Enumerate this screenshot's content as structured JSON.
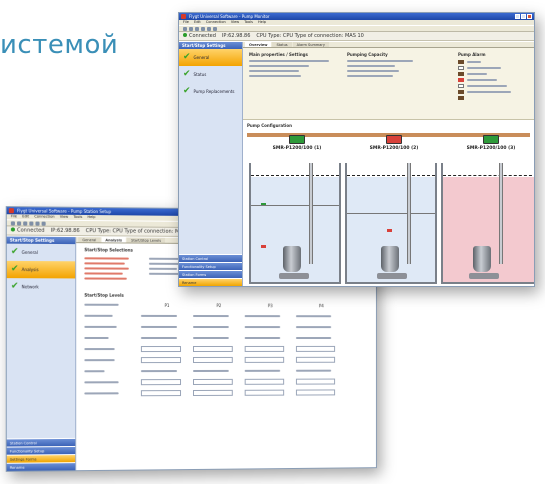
{
  "promo": {
    "text": "истемой"
  },
  "back_window": {
    "title": "Flygt Universal Software - Pump Station Setup",
    "menu": [
      "File",
      "Edit",
      "Connection",
      "View",
      "Tools",
      "Help"
    ],
    "status": {
      "connected": "Connected",
      "ip": "IP:62.98.86",
      "cpu": "CPU Type: CPU Type of connection: MAS 10"
    },
    "side_title": "Start/Stop Settings",
    "nav": [
      {
        "label": "General",
        "active": false
      },
      {
        "label": "Analysis",
        "active": true
      },
      {
        "label": "Network",
        "active": false
      }
    ],
    "footer": [
      "Station Control",
      "Functionality Setup",
      "Settings Forms",
      "Rename"
    ],
    "tabs": [
      "General",
      "Analysis",
      "Start/Stop Levels"
    ],
    "section1": "Start/Stop Selections",
    "section2": "Start/Stop Levels",
    "columns": [
      "P1",
      "P2",
      "P3",
      "P4"
    ]
  },
  "front_window": {
    "title": "Flygt Universal Software - Pump Monitor",
    "menu": [
      "File",
      "Edit",
      "Connection",
      "View",
      "Tools",
      "Help"
    ],
    "status": {
      "connected": "Connected",
      "ip": "IP:62.98.86",
      "cpu": "CPU Type: CPU Type of connection: MAS 10"
    },
    "side_title": "Start/Stop Settings",
    "nav": [
      {
        "label": "General",
        "active": true
      },
      {
        "label": "Status",
        "active": false
      },
      {
        "label": "Pump Replacements",
        "active": false
      }
    ],
    "footer": [
      "Station Control",
      "Functionality Setup",
      "Station Forms",
      "Rename"
    ],
    "tabs": [
      "Overview",
      "Status",
      "Alarm Summary"
    ],
    "info_headers": [
      "Main properties / Settings",
      "Pumping Capacity",
      "Pump Alarm"
    ],
    "pump_section": "Pump Configuration",
    "pumps": [
      {
        "name": "SMR-P1200/100 (1)",
        "badge_color": "#2e9a3a"
      },
      {
        "name": "SMR-P1200/100 (2)",
        "badge_color": "#d8413a"
      },
      {
        "name": "SMR-P1200/100 (3)",
        "badge_color": "#2e9a3a"
      }
    ]
  },
  "colors": {
    "accent": "#3a8fb7",
    "nav_active": "#f3a300",
    "water_blue": "#dfe9f6",
    "water_red": "#f3c9cf",
    "alarm_red": "#d8413a",
    "ok_green": "#2e9a3a"
  },
  "icons": {
    "check": "check-icon",
    "pump": "pump-icon"
  }
}
